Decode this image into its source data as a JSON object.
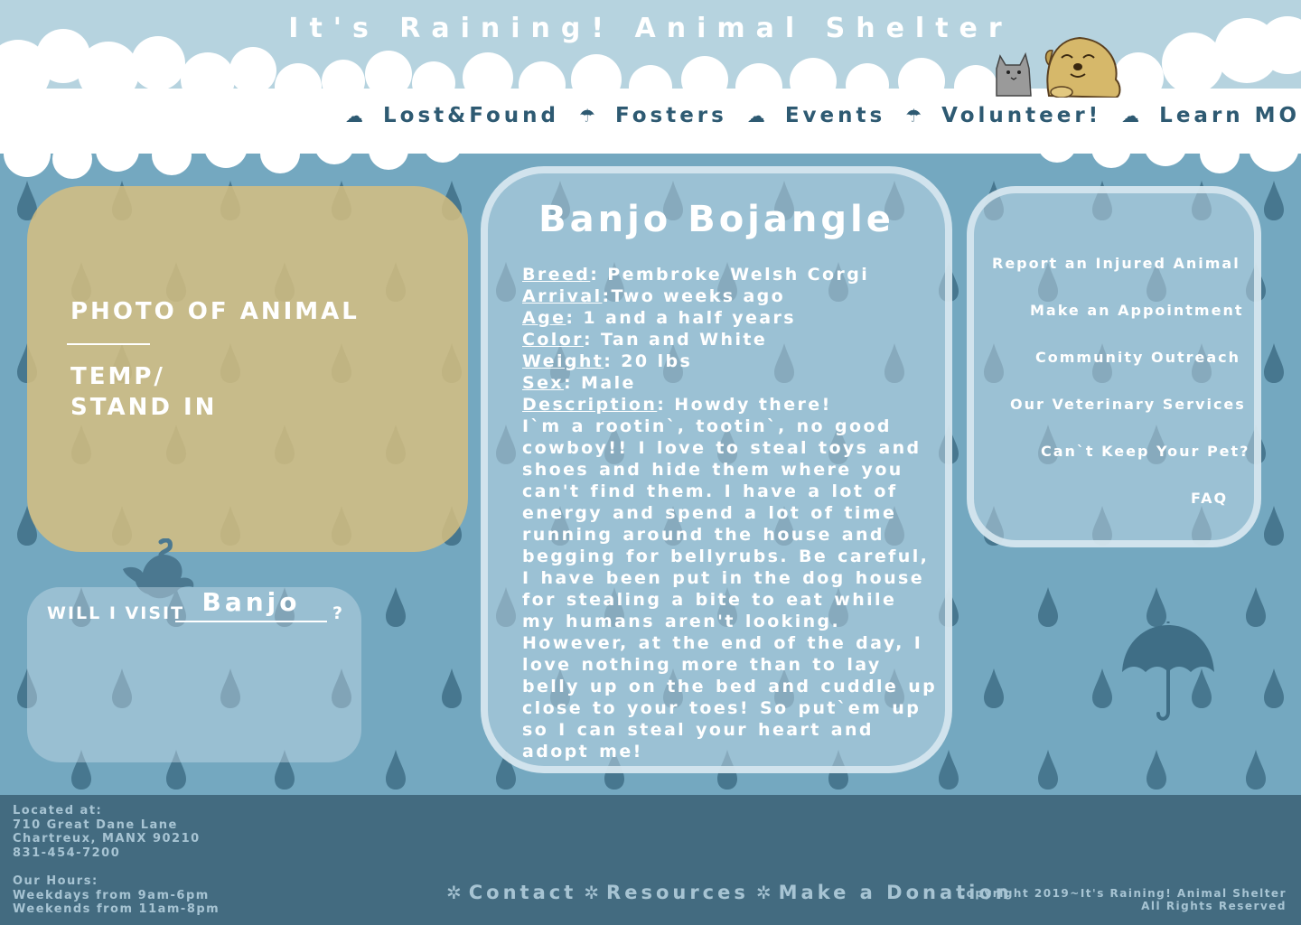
{
  "site": {
    "title": "It's Raining! Animal Shelter"
  },
  "nav": {
    "separators": [
      "☁",
      "☂",
      "☁",
      "☂",
      "☁"
    ],
    "items": [
      "Lost&Found",
      "Fosters",
      "Events",
      "Volunteer!",
      "Learn MORE"
    ]
  },
  "photo": {
    "label": "PHOTO OF ANIMAL",
    "temp_line1": "TEMP/",
    "temp_line2": "STAND IN"
  },
  "visit": {
    "prefix": "WILL I VISIT",
    "name": "Banjo",
    "suffix": "?"
  },
  "profile": {
    "name": "Banjo Bojangle",
    "fields": [
      {
        "label": "Breed",
        "value": ": Pembroke Welsh Corgi"
      },
      {
        "label": "Arrival",
        "value": ":Two weeks ago"
      },
      {
        "label": "Age",
        "value": ": 1 and a half years"
      },
      {
        "label": "Color",
        "value": ": Tan and White"
      },
      {
        "label": "Weight",
        "value": ": 20 lbs"
      },
      {
        "label": "Sex",
        "value": ": Male"
      },
      {
        "label": "Description",
        "value": ": Howdy there!"
      }
    ],
    "description": "I`m a rootin`, tootin`, no good cowboy!! I love to steal toys and shoes and hide them where you can't find them. I have a lot of energy and spend a lot of time running around the house and begging for bellyrubs. Be careful, I have been put in the dog house for stealing a bite to eat while my humans aren't looking. However, at the end of the day, I love nothing more than to lay belly up on the bed and cuddle up close to your toes! So put`em up so I can steal your heart and adopt me!"
  },
  "side_links": [
    "Report an Injured Animal",
    "Make an Appointment",
    "Community Outreach",
    "Our Veterinary Services",
    "Can`t Keep Your Pet?",
    "FAQ"
  ],
  "footer": {
    "address_label": "Located at:",
    "address_line1": "710 Great Dane Lane",
    "address_line2": "Chartreux, MANX 90210",
    "phone": "831-454-7200",
    "hours_label": "Our Hours:",
    "hours_weekdays": "Weekdays from 9am-6pm",
    "hours_weekends": "Weekends from 11am-8pm",
    "links": [
      "Contact",
      "Resources",
      "Make a Donation"
    ],
    "link_icon": "✲",
    "copyright_line1": "Copyright 2019~It's Raining! Animal Shelter",
    "copyright_line2": "All Rights Reserved"
  },
  "colors": {
    "background": "#74a8c0",
    "sky": "#b6d3df",
    "nav_text": "#2e5a72",
    "footer": "#436b80",
    "footer_text": "#a7c4d3",
    "photo_panel": "#d6be80",
    "raindrop": "#3f6e86"
  }
}
